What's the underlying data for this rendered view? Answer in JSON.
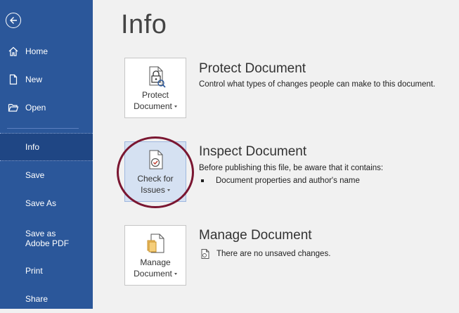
{
  "sidebar": {
    "items": [
      {
        "label": "Home",
        "icon": "home-icon"
      },
      {
        "label": "New",
        "icon": "new-document-icon"
      },
      {
        "label": "Open",
        "icon": "folder-open-icon"
      },
      {
        "label": "Info",
        "active": true
      },
      {
        "label": "Save"
      },
      {
        "label": "Save As"
      },
      {
        "label": "Save as Adobe PDF"
      },
      {
        "label": "Print"
      },
      {
        "label": "Share"
      }
    ],
    "accent_color": "#2b579a"
  },
  "page": {
    "title": "Info"
  },
  "protect": {
    "button_line1": "Protect",
    "button_line2": "Document",
    "title": "Protect Document",
    "description": "Control what types of changes people can make to this document."
  },
  "inspect": {
    "button_line1": "Check for",
    "button_line2": "Issues",
    "title": "Inspect Document",
    "description": "Before publishing this file, be aware that it contains:",
    "bullets": [
      "Document properties and author's name"
    ]
  },
  "manage": {
    "button_line1": "Manage",
    "button_line2": "Document",
    "title": "Manage Document",
    "status": "There are no unsaved changes."
  },
  "highlight_color": "#7a1631"
}
